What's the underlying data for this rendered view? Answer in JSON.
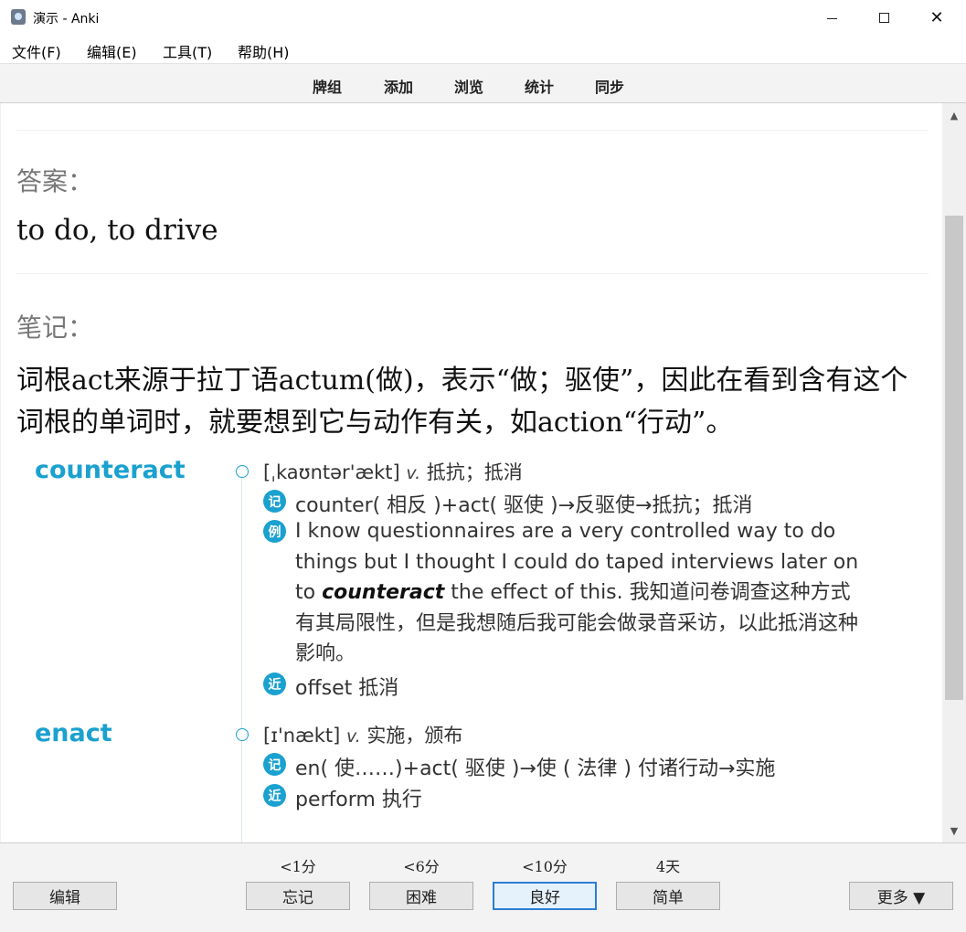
{
  "window": {
    "title": "演示 - Anki",
    "minimize_glyph": "",
    "maximize_glyph": "",
    "close_glyph": "✕"
  },
  "menu": [
    "文件(F)",
    "编辑(E)",
    "工具(T)",
    "帮助(H)"
  ],
  "toolbar": [
    "牌组",
    "添加",
    "浏览",
    "统计",
    "同步"
  ],
  "card": {
    "answer_label": "答案：",
    "answer_text": "to do, to drive",
    "note_label": "笔记：",
    "note_text": "词根act来源于拉丁语actum(做)，表示“做；驱使”，因此在看到含有这个词根的单词时，就要想到它与动作有关，如action“行动”。"
  },
  "dictionary": {
    "entries": [
      {
        "word": "counteract",
        "phonetic": "[ˌkaʊntər'ækt]",
        "pos": "v.",
        "meaning": "抵抗；抵消",
        "memo_badge": "记",
        "memo": "counter( 相反 )+act( 驱使 )→反驱使→抵抗；抵消",
        "example_badge": "例",
        "example_line1": "I know questionnaires are a very controlled way to do",
        "example_line2": "things but I thought I could do taped interviews later on",
        "example_line3_pre": "to",
        "example_line3_word": "counteract",
        "example_line3_post": "the effect of this. 我知道问卷调查这种方式",
        "example_line4": "有其局限性，但是我想随后我可能会做录音采访，以此抵消这种",
        "example_line5": "影响。",
        "synonym_badge": "近",
        "synonym": "offset 抵消"
      },
      {
        "word": "enact",
        "phonetic": "[ɪ'nækt]",
        "pos": "v.",
        "meaning": "实施，颁布",
        "memo_badge": "记",
        "memo": "en( 使……)+act( 驱使 )→使 ( 法律 ) 付诸行动→实施",
        "synonym_badge": "近",
        "synonym": "perform 执行"
      }
    ]
  },
  "scrollbar": {
    "up_glyph": "▲",
    "down_glyph": "▼"
  },
  "bottom": {
    "edit_label": "编辑",
    "more_label": "更多 ▼",
    "answers": [
      {
        "interval": "<1分",
        "label": "忘记"
      },
      {
        "interval": "<6分",
        "label": "困难"
      },
      {
        "interval": "<10分",
        "label": "良好"
      },
      {
        "interval": "4天",
        "label": "简单"
      }
    ]
  }
}
